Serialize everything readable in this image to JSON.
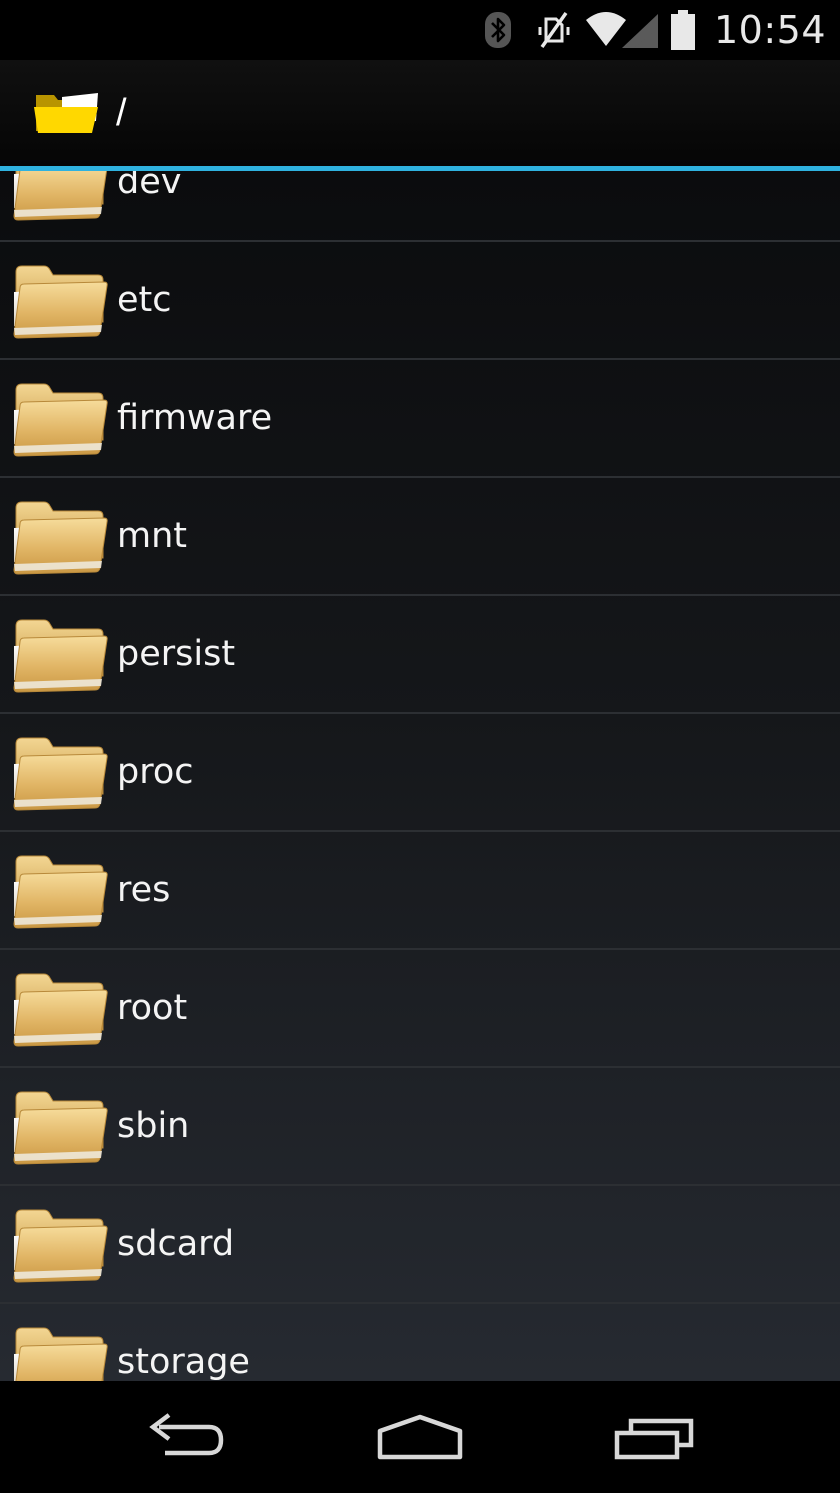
{
  "status_bar": {
    "time": "10:54",
    "icons": [
      "bluetooth-icon",
      "vibrate-mute-icon",
      "wifi-icon",
      "signal-icon",
      "battery-icon"
    ]
  },
  "action_bar": {
    "icon": "open-folder-icon",
    "path": "/"
  },
  "folders": [
    {
      "name": "dev"
    },
    {
      "name": "etc"
    },
    {
      "name": "firmware"
    },
    {
      "name": "mnt"
    },
    {
      "name": "persist"
    },
    {
      "name": "proc"
    },
    {
      "name": "res"
    },
    {
      "name": "root"
    },
    {
      "name": "sbin"
    },
    {
      "name": "sdcard"
    },
    {
      "name": "storage"
    }
  ],
  "colors": {
    "accent": "#2fb2df",
    "folder": "#e6c37a",
    "action_folder": "#ffd800"
  },
  "nav_bar": {
    "buttons": [
      "back-icon",
      "home-icon",
      "recents-icon"
    ]
  }
}
